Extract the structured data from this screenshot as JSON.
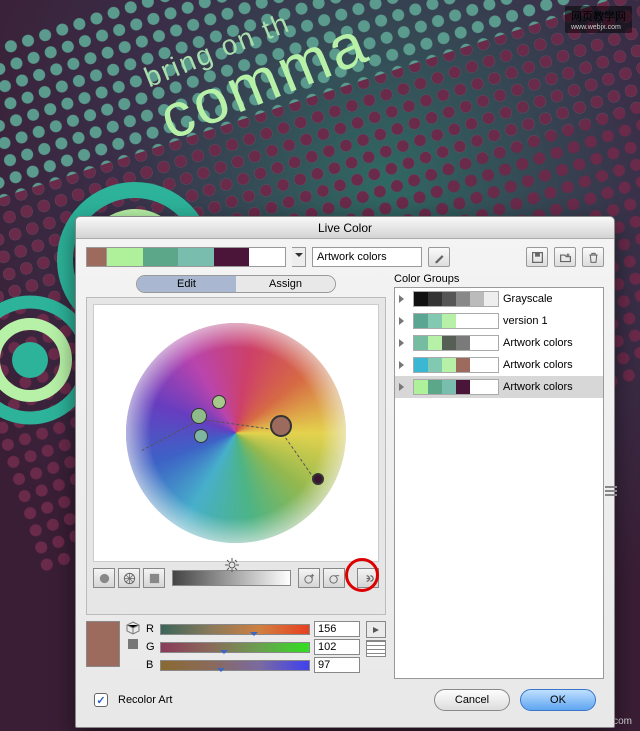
{
  "dialog": {
    "title": "Live Color",
    "harmony_dropdown_label": "Artwork colors",
    "tabs": {
      "edit": "Edit",
      "assign": "Assign"
    },
    "palette_swatches": [
      "#aff19a",
      "#5ca68a",
      "#79bdae",
      "#4b153a",
      "#ffffff"
    ],
    "current_swatch": "#9c6b5e"
  },
  "rgb": {
    "r_label": "R",
    "g_label": "G",
    "b_label": "B",
    "r_value": "156",
    "g_value": "102",
    "b_value": "97"
  },
  "color_groups": {
    "title": "Color Groups",
    "rows": [
      {
        "name": "Grayscale",
        "swatches": [
          "#111",
          "#333",
          "#555",
          "#888",
          "#bbb",
          "#eee"
        ]
      },
      {
        "name": "version 1",
        "swatches": [
          "#5aa693",
          "#83c9b1",
          "#b7f1a7",
          "#ffffff",
          "#ffffff",
          "#ffffff"
        ]
      },
      {
        "name": "Artwork colors",
        "swatches": [
          "#76bca1",
          "#b7f1a7",
          "#565e56",
          "#7a7a7a",
          "#ffffff",
          "#ffffff"
        ]
      },
      {
        "name": "Artwork colors",
        "swatches": [
          "#3ab7d2",
          "#82c9b1",
          "#b7f1a7",
          "#9c6b5e",
          "#ffffff",
          "#ffffff"
        ]
      },
      {
        "name": "Artwork colors",
        "swatches": [
          "#aff19a",
          "#5ca68a",
          "#79bdae",
          "#4b153a",
          "#ffffff",
          "#ffffff"
        ]
      }
    ],
    "selected_index": 4
  },
  "footer": {
    "recolor_label": "Recolor Art",
    "cancel": "Cancel",
    "ok": "OK"
  },
  "watermark": {
    "top_cn": "网页教学网",
    "top_url": "www.webjx.com",
    "bottom": "jiaocheng.chazidian.com"
  },
  "bg_text": {
    "line1": "bring on th",
    "line2": "comma"
  }
}
